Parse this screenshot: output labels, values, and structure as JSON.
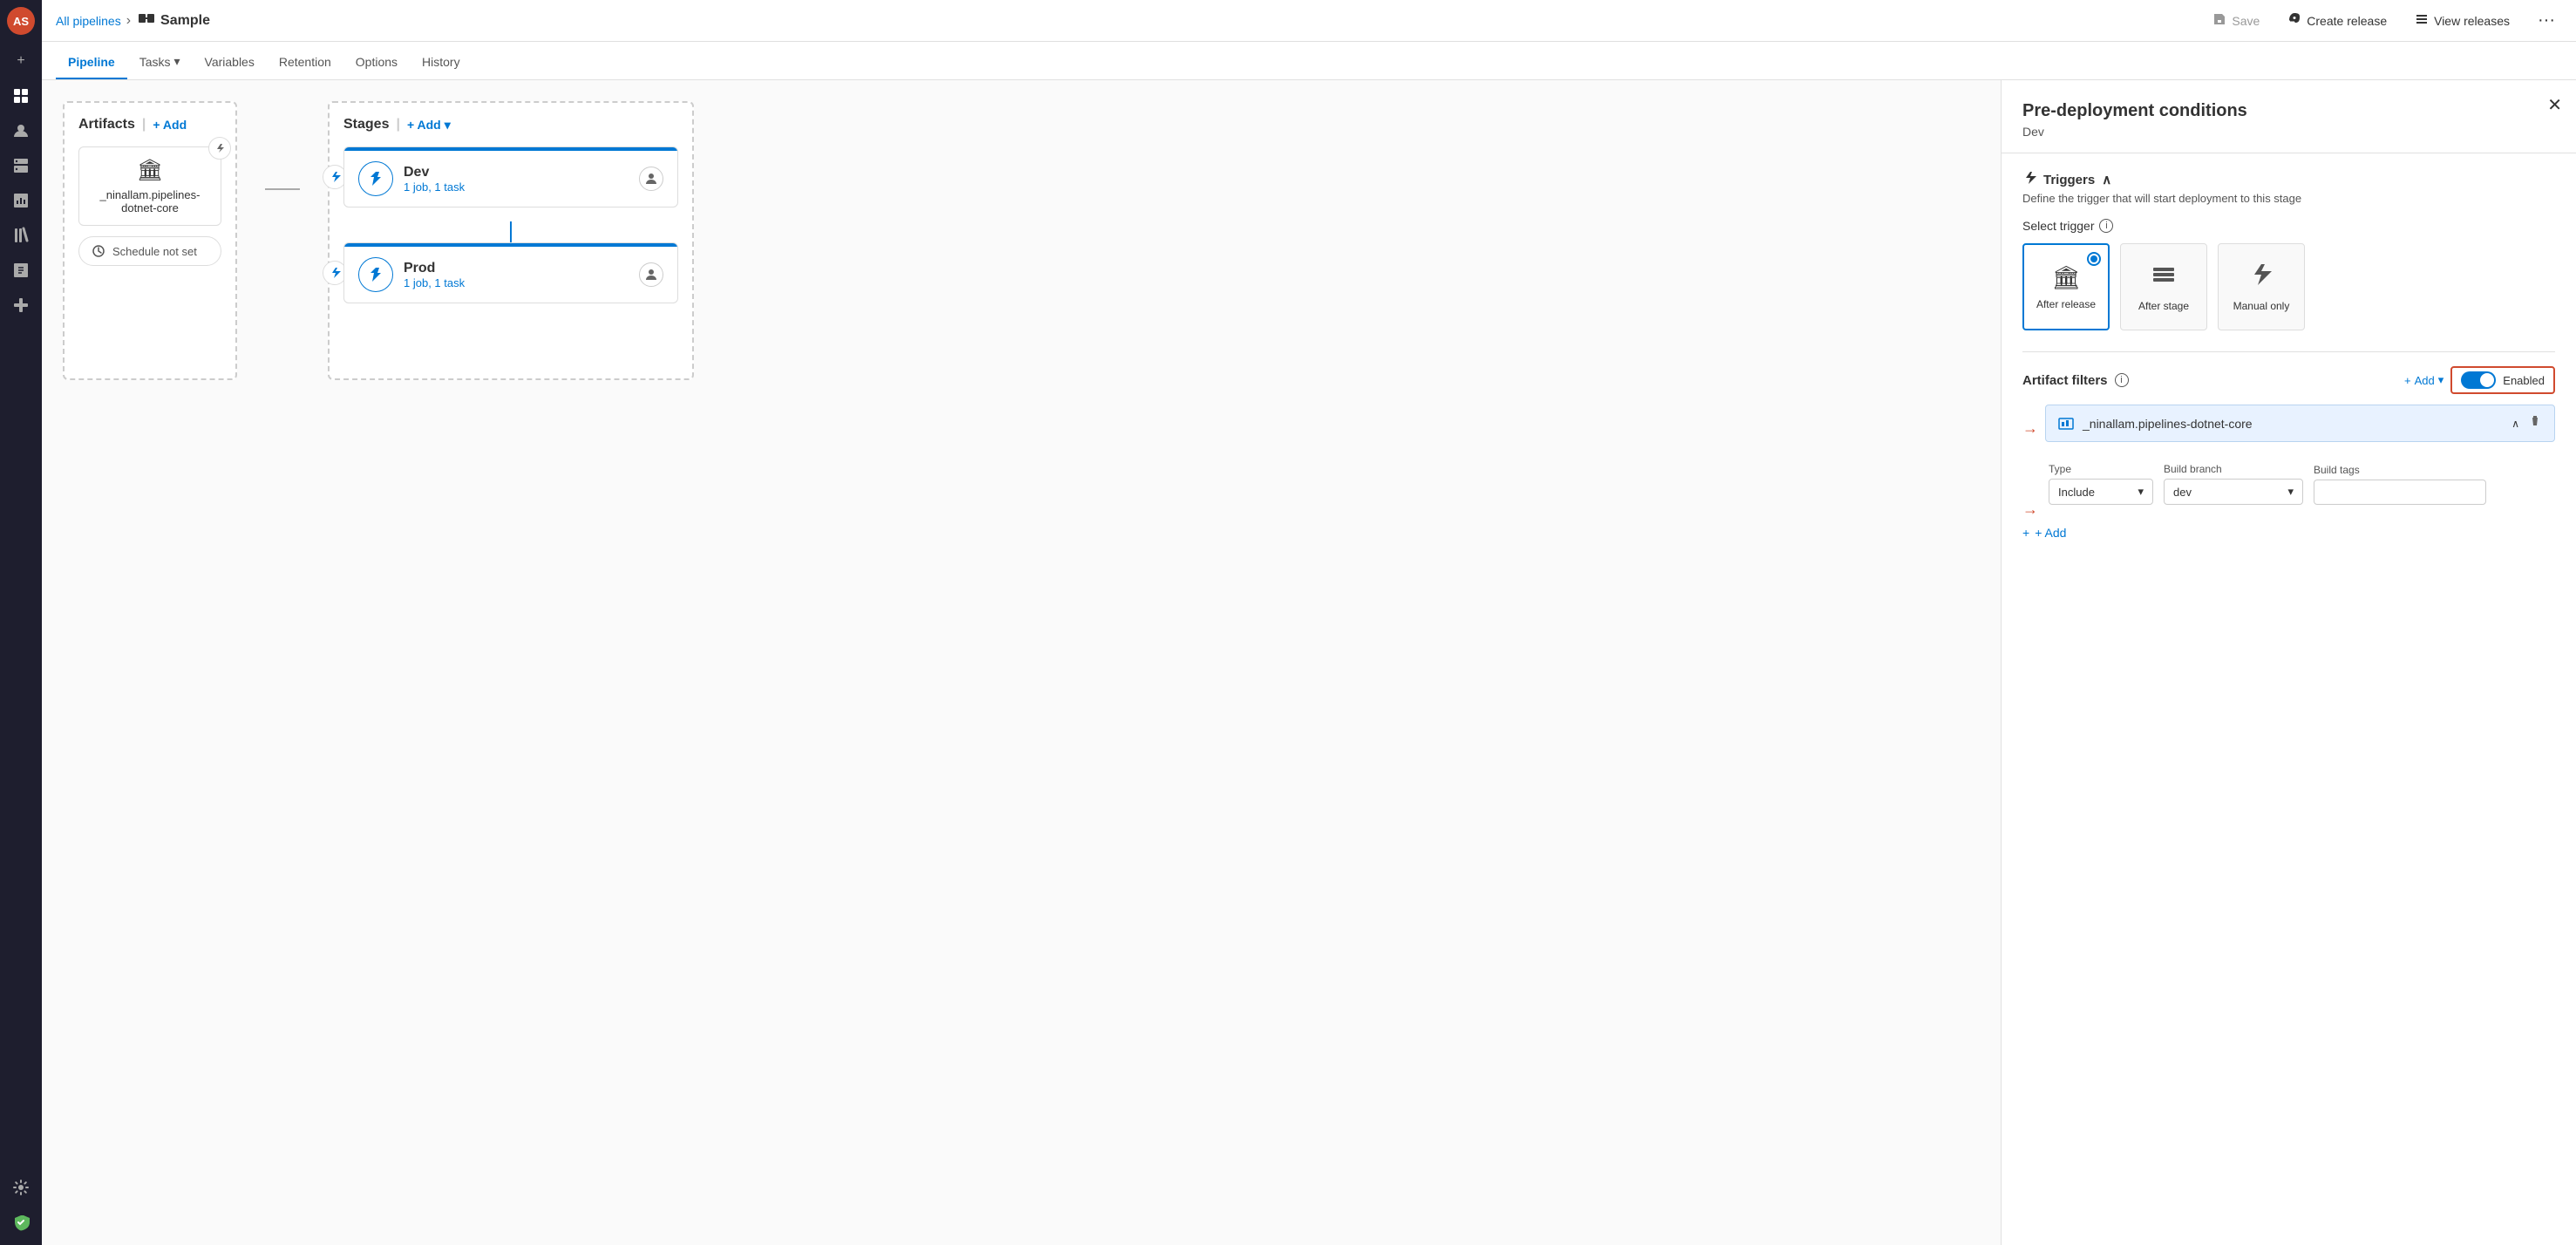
{
  "sidebar": {
    "avatar": "AS",
    "icons": [
      {
        "name": "plus-icon",
        "symbol": "+"
      },
      {
        "name": "pipelines-icon",
        "symbol": "⎇"
      },
      {
        "name": "user-icon",
        "symbol": "👤"
      },
      {
        "name": "deploy-icon",
        "symbol": "🏗"
      },
      {
        "name": "reports-icon",
        "symbol": "📊"
      },
      {
        "name": "library-icon",
        "symbol": "📚"
      },
      {
        "name": "test-icon",
        "symbol": "🖥"
      },
      {
        "name": "tasks-icon",
        "symbol": "⠿"
      },
      {
        "name": "settings-icon",
        "symbol": "⚙"
      },
      {
        "name": "security-icon",
        "symbol": "🛡"
      }
    ]
  },
  "topbar": {
    "breadcrumb": "All pipelines",
    "separator": "›",
    "pipeline_icon": "⎇",
    "title": "Sample",
    "save_label": "Save",
    "create_release_label": "Create release",
    "view_releases_label": "View releases",
    "more_icon": "···"
  },
  "tabs": [
    {
      "label": "Pipeline",
      "active": true
    },
    {
      "label": "Tasks",
      "has_dropdown": true
    },
    {
      "label": "Variables"
    },
    {
      "label": "Retention"
    },
    {
      "label": "Options"
    },
    {
      "label": "History"
    }
  ],
  "canvas": {
    "artifacts_header": "Artifacts",
    "artifacts_add": "+ Add",
    "artifact_name": "_ninallam.pipelines-dotnet-core",
    "schedule_label": "Schedule not set",
    "stages_header": "Stages",
    "stages_add": "+ Add",
    "stages": [
      {
        "name": "Dev",
        "tasks": "1 job, 1 task"
      },
      {
        "name": "Prod",
        "tasks": "1 job, 1 task"
      }
    ]
  },
  "panel": {
    "title": "Pre-deployment conditions",
    "subtitle": "Dev",
    "close_icon": "✕",
    "triggers_label": "Triggers",
    "triggers_desc": "Define the trigger that will start deployment to this stage",
    "select_trigger_label": "Select trigger",
    "trigger_options": [
      {
        "id": "after_release",
        "label": "After release",
        "icon": "🏛",
        "selected": true
      },
      {
        "id": "after_stage",
        "label": "After stage",
        "icon": "☰"
      },
      {
        "id": "manual_only",
        "label": "Manual only",
        "icon": "⚡"
      }
    ],
    "artifact_filters_label": "Artifact filters",
    "artifact_filters_enabled": "Enabled",
    "add_filter_label": "+ Add",
    "artifact_filter_name": "_ninallam.pipelines-dotnet-core",
    "type_label": "Type",
    "type_value": "Include",
    "build_branch_label": "Build branch",
    "build_branch_value": "dev",
    "build_tags_label": "Build tags",
    "add_filter_row_label": "+ Add"
  }
}
